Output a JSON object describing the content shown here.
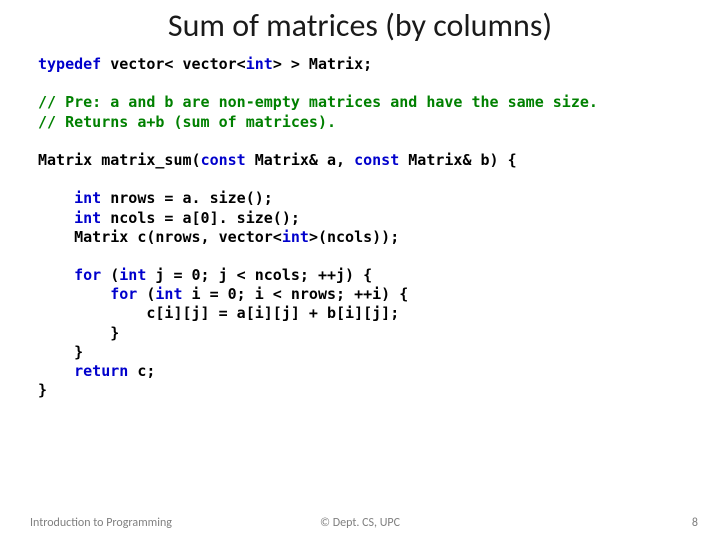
{
  "title": "Sum of matrices (by columns)",
  "code": {
    "l1a": "typedef",
    "l1b": " vector< vector<",
    "l1c": "int",
    "l1d": "> > Matrix;",
    "blank1": "",
    "l2": "// Pre: a and b are non-empty matrices and have the same size.",
    "l3": "// Returns a+b (sum of matrices).",
    "blank2": "",
    "l4a": "Matrix matrix_sum(",
    "l4b": "const",
    "l4c": " Matrix& a, ",
    "l4d": "const",
    "l4e": " Matrix& b) {",
    "blank3": "",
    "l5a": "    ",
    "l5b": "int",
    "l5c": " nrows = a. size();",
    "l6a": "    ",
    "l6b": "int",
    "l6c": " ncols = a[0]. size();",
    "l7a": "    Matrix c(nrows, vector<",
    "l7b": "int",
    "l7c": ">(ncols));",
    "blank4": "",
    "l8a": "    ",
    "l8b": "for",
    "l8c": " (",
    "l8d": "int",
    "l8e": " j = 0; j < ncols; ++j) {",
    "l9a": "        ",
    "l9b": "for",
    "l9c": " (",
    "l9d": "int",
    "l9e": " i = 0; i < nrows; ++i) {",
    "l10": "            c[i][j] = a[i][j] + b[i][j];",
    "l11": "        }",
    "l12": "    }",
    "l13a": "    ",
    "l13b": "return",
    "l13c": " c;",
    "l14": "}"
  },
  "footer": {
    "left": "Introduction to Programming",
    "center": "© Dept. CS, UPC",
    "right": "8"
  }
}
